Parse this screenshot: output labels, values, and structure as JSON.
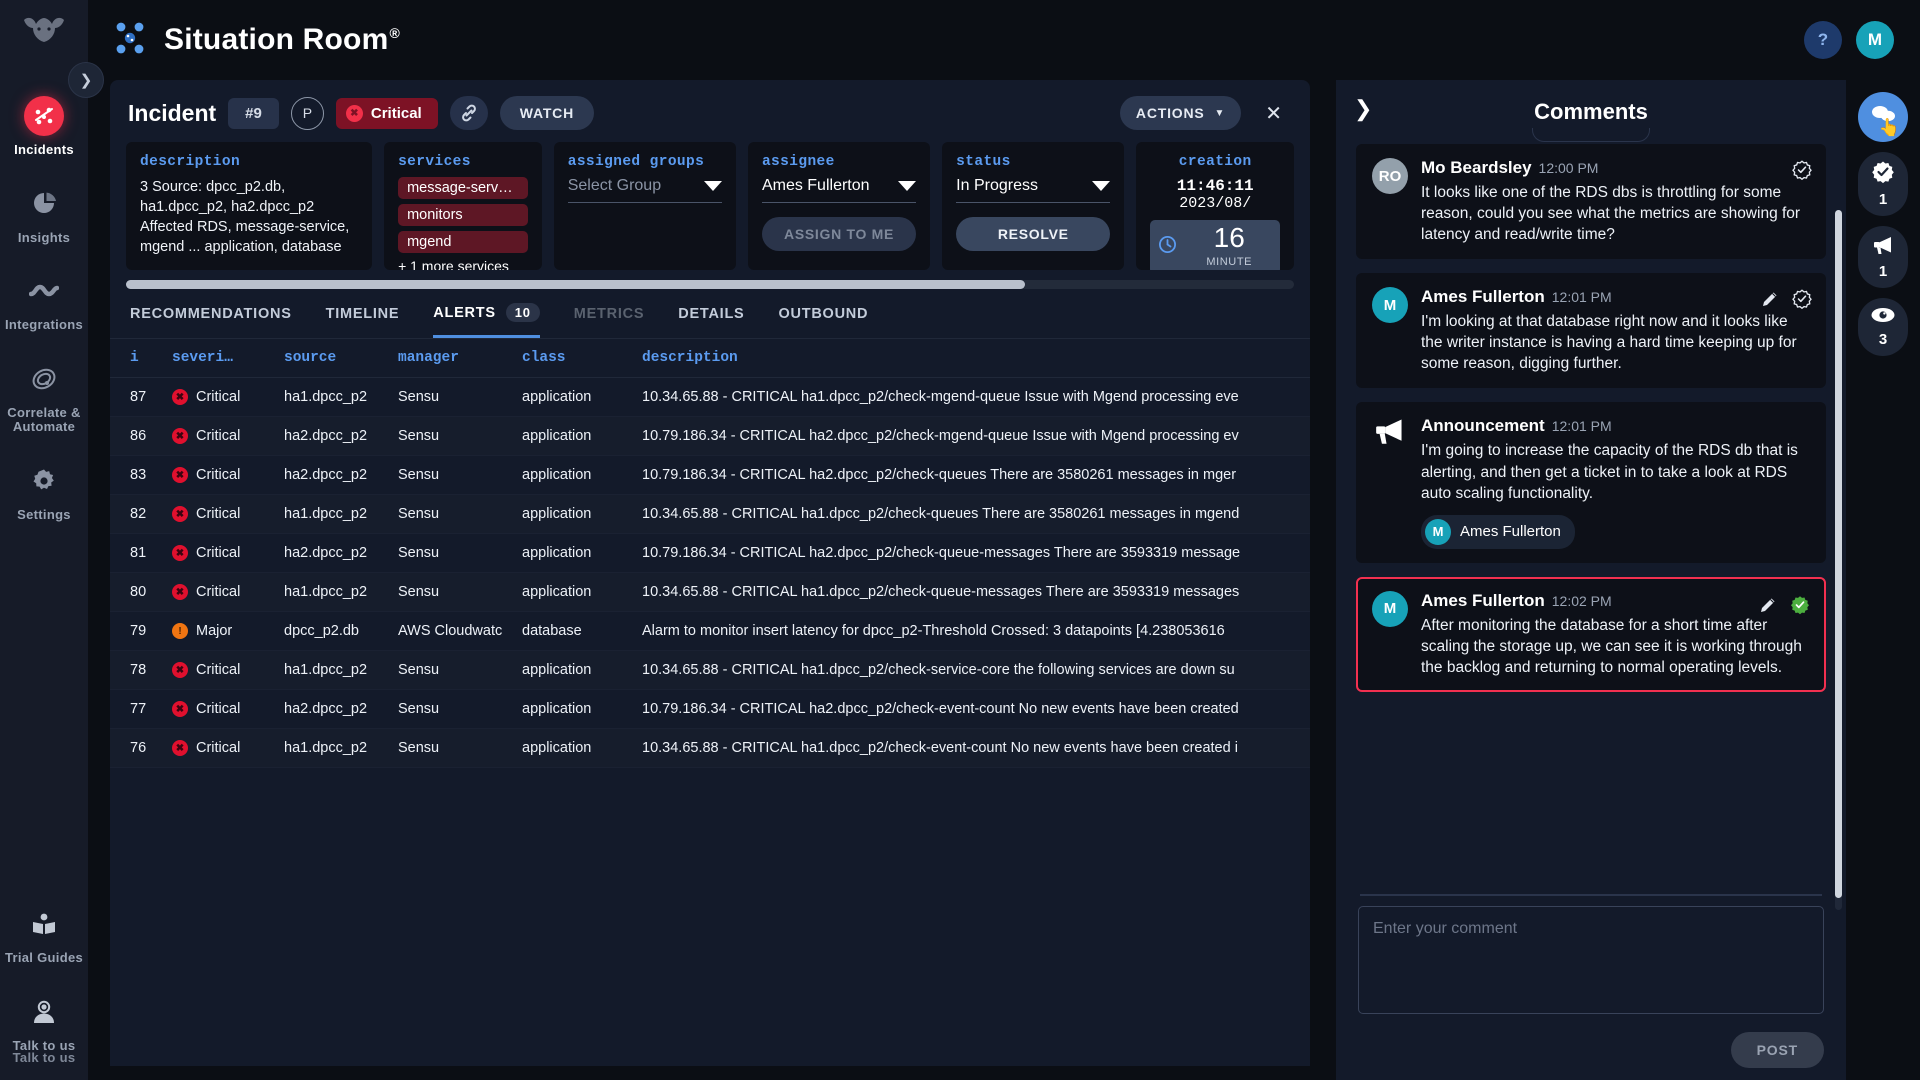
{
  "sidebar": {
    "logo_icon": "bull-logo-icon",
    "expand_icon": "chevron-right-icon",
    "items": [
      {
        "label": "Incidents",
        "icon": "incidents-icon",
        "active": true
      },
      {
        "label": "Insights",
        "icon": "pie-chart-icon",
        "active": false
      },
      {
        "label": "Integrations",
        "icon": "integrations-icon",
        "active": false
      },
      {
        "label": "Correlate &\nAutomate",
        "icon": "correlate-icon",
        "active": false
      },
      {
        "label": "Settings",
        "icon": "gear-icon",
        "active": false
      }
    ],
    "bottom_items": [
      {
        "label": "Trial Guides",
        "icon": "book-icon"
      },
      {
        "label": "Talk to us",
        "icon": "headset-icon"
      },
      {
        "label": "Talk to us",
        "icon": "headset-icon-shadow"
      }
    ]
  },
  "topbar": {
    "title": "Situation Room",
    "trademark": "®",
    "logo_icon": "bigpanda-logo-icon",
    "help_label": "?",
    "avatar_label": "M"
  },
  "incident": {
    "title": "Incident",
    "number": "#9",
    "priority": "P",
    "severity": "Critical",
    "link_icon": "link-icon",
    "watch_label": "WATCH",
    "actions_label": "ACTIONS",
    "close_icon": "close-icon",
    "cards": {
      "description": {
        "label": "description",
        "text": "3 Source: dpcc_p2.db, ha1.dpcc_p2, ha2.dpcc_p2 Affected RDS, message-service, mgend ... application, database"
      },
      "services": {
        "label": "services",
        "pills": [
          "message-serv…",
          "monitors",
          "mgend"
        ],
        "more": "+ 1 more services"
      },
      "assigned_groups": {
        "label": "assigned groups",
        "value": "Select Group",
        "is_placeholder": true
      },
      "assignee": {
        "label": "assignee",
        "value": "Ames Fullerton",
        "button": "ASSIGN TO ME"
      },
      "status": {
        "label": "status",
        "value": "In Progress",
        "button": "RESOLVE"
      },
      "creation": {
        "label": "creation",
        "time": "11:46:11",
        "date": "2023/08/",
        "timer_icon": "clock-icon",
        "timer_value": "16",
        "timer_unit": "MINUTE"
      }
    },
    "tabs": [
      {
        "label": "RECOMMENDATIONS",
        "badge": "",
        "active": false,
        "disabled": false
      },
      {
        "label": "TIMELINE",
        "badge": "",
        "active": false,
        "disabled": false
      },
      {
        "label": "ALERTS",
        "badge": "10",
        "active": true,
        "disabled": false
      },
      {
        "label": "METRICS",
        "badge": "",
        "active": false,
        "disabled": true
      },
      {
        "label": "DETAILS",
        "badge": "",
        "active": false,
        "disabled": false
      },
      {
        "label": "OUTBOUND",
        "badge": "",
        "active": false,
        "disabled": false
      }
    ],
    "table": {
      "columns": [
        "i",
        "severi…",
        "source",
        "manager",
        "class",
        "description"
      ],
      "rows": [
        {
          "i": "87",
          "severity": "Critical",
          "source": "ha1.dpcc_p2",
          "manager": "Sensu",
          "class": "application",
          "description": "10.34.65.88 - CRITICAL ha1.dpcc_p2/check-mgend-queue Issue with Mgend processing eve"
        },
        {
          "i": "86",
          "severity": "Critical",
          "source": "ha2.dpcc_p2",
          "manager": "Sensu",
          "class": "application",
          "description": "10.79.186.34 - CRITICAL ha2.dpcc_p2/check-mgend-queue Issue with Mgend processing ev"
        },
        {
          "i": "83",
          "severity": "Critical",
          "source": "ha2.dpcc_p2",
          "manager": "Sensu",
          "class": "application",
          "description": "10.79.186.34 - CRITICAL ha2.dpcc_p2/check-queues There are 3580261 messages in mger"
        },
        {
          "i": "82",
          "severity": "Critical",
          "source": "ha1.dpcc_p2",
          "manager": "Sensu",
          "class": "application",
          "description": "10.34.65.88 - CRITICAL ha1.dpcc_p2/check-queues There are 3580261 messages in mgend"
        },
        {
          "i": "81",
          "severity": "Critical",
          "source": "ha2.dpcc_p2",
          "manager": "Sensu",
          "class": "application",
          "description": "10.79.186.34 - CRITICAL ha2.dpcc_p2/check-queue-messages There are 3593319 message"
        },
        {
          "i": "80",
          "severity": "Critical",
          "source": "ha1.dpcc_p2",
          "manager": "Sensu",
          "class": "application",
          "description": "10.34.65.88 - CRITICAL ha1.dpcc_p2/check-queue-messages There are 3593319 messages"
        },
        {
          "i": "79",
          "severity": "Major",
          "source": "dpcc_p2.db",
          "manager": "AWS Cloudwatc",
          "class": "database",
          "description": "Alarm to monitor insert latency for dpcc_p2-Threshold Crossed: 3 datapoints [4.238053616"
        },
        {
          "i": "78",
          "severity": "Critical",
          "source": "ha1.dpcc_p2",
          "manager": "Sensu",
          "class": "application",
          "description": "10.34.65.88 - CRITICAL ha1.dpcc_p2/check-service-core the following services are down su"
        },
        {
          "i": "77",
          "severity": "Critical",
          "source": "ha2.dpcc_p2",
          "manager": "Sensu",
          "class": "application",
          "description": "10.79.186.34 - CRITICAL ha2.dpcc_p2/check-event-count No new events have been created"
        },
        {
          "i": "76",
          "severity": "Critical",
          "source": "ha1.dpcc_p2",
          "manager": "Sensu",
          "class": "application",
          "description": "10.34.65.88 - CRITICAL ha1.dpcc_p2/check-event-count No new events have been created i"
        }
      ]
    }
  },
  "comments": {
    "title": "Comments",
    "back_icon": "chevron-right-icon",
    "items": [
      {
        "type": "comment",
        "avatar_initials": "RO",
        "avatar_color": "#93a0ab",
        "author": "Mo Beardsley",
        "time": "12:00 PM",
        "text": "It looks like one of the RDS dbs is throttling for some reason, could you see what the metrics are showing for latency and read/write time?",
        "has_edit": false,
        "verified_icon": "verified-badge-icon",
        "highlighted": false
      },
      {
        "type": "comment",
        "avatar_initials": "M",
        "avatar_color": "#17a2b8",
        "author": "Ames Fullerton",
        "time": "12:01 PM",
        "text": "I'm looking at that database right now and it looks like the writer instance is having a hard time keeping up for some reason, digging further.",
        "has_edit": true,
        "verified_icon": "verified-badge-icon",
        "highlighted": false
      },
      {
        "type": "announcement",
        "icon": "megaphone-icon",
        "author": "Announcement",
        "time": "12:01 PM",
        "text": "I'm going to increase the capacity of the RDS db that is alerting, and then get a ticket in to take a look at RDS auto scaling functionality.",
        "announcer_initial": "M",
        "announcer_name": "Ames Fullerton",
        "highlighted": false
      },
      {
        "type": "comment",
        "avatar_initials": "M",
        "avatar_color": "#17a2b8",
        "author": "Ames Fullerton",
        "time": "12:02 PM",
        "text": "After monitoring the database for a short time after scaling the storage up, we can see it is working through the backlog and returning to normal operating levels.",
        "has_edit": true,
        "verified_icon": "verified-badge-green-icon",
        "highlighted": true
      }
    ],
    "input_placeholder": "Enter your comment",
    "input_value": "",
    "post_label": "POST"
  },
  "rail": [
    {
      "icon": "comments-icon",
      "count": "",
      "active": true
    },
    {
      "icon": "verified-icon",
      "count": "1",
      "active": false
    },
    {
      "icon": "megaphone-icon",
      "count": "1",
      "active": false
    },
    {
      "icon": "eye-icon",
      "count": "3",
      "active": false
    }
  ],
  "colors": {
    "accent_blue": "#4f8fe0",
    "critical_red": "#f23049",
    "major_orange": "#f07512",
    "panel_bg": "#131a2a",
    "card_bg": "#0d1018",
    "teal": "#17a2b8"
  }
}
